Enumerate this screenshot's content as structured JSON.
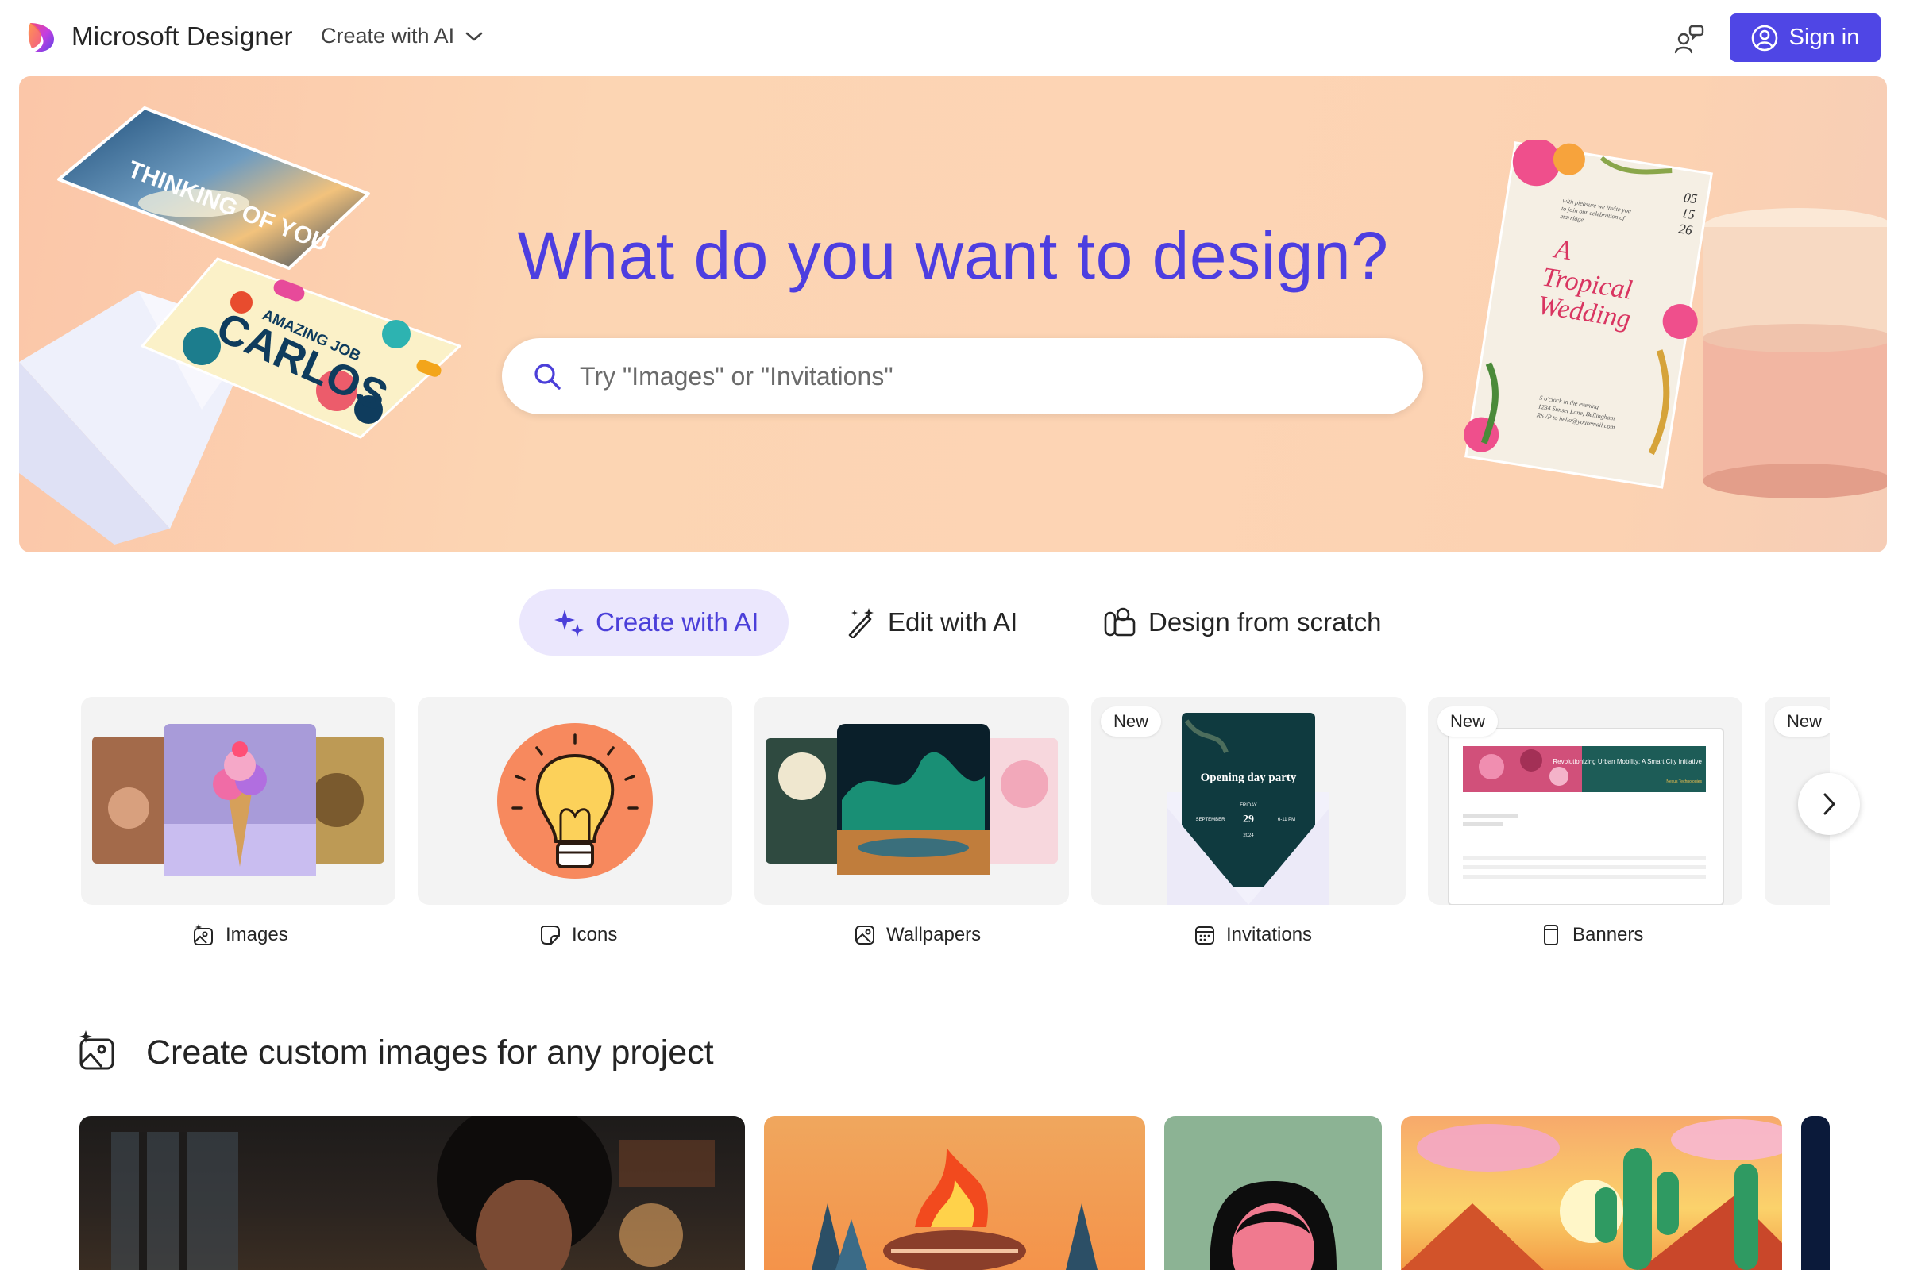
{
  "app": {
    "brand": "Microsoft Designer",
    "create_menu_label": "Create with AI",
    "sign_in_label": "Sign in",
    "accent_color": "#4f46e5"
  },
  "hero": {
    "title": "What do you want to design?",
    "search_placeholder": "Try \"Images\" or \"Invitations\"",
    "deco_cards": {
      "thinking_text": "THINKING OF YOU",
      "amazing_text": "AMAZING JOB",
      "carlos_text": "CARLOS",
      "invite_date": [
        "05",
        "15",
        "26"
      ],
      "invite_intro": [
        "with pleasure we invite you",
        "to join our celebration of",
        "marriage"
      ],
      "invite_title": [
        "A",
        "Tropical",
        "Wedding"
      ],
      "invite_footer": [
        "5 o'clock in the evening",
        "1234 Sunset Lane, Bellingham",
        "RSVP to hello@youremail.com"
      ]
    }
  },
  "tabs": [
    {
      "label": "Create with AI",
      "icon": "sparkle-icon",
      "active": true
    },
    {
      "label": "Edit with AI",
      "icon": "magic-wand-icon",
      "active": false
    },
    {
      "label": "Design from scratch",
      "icon": "shapes-icon",
      "active": false
    }
  ],
  "categories": [
    {
      "label": "Images",
      "icon": "image-sparkle-icon",
      "badge": ""
    },
    {
      "label": "Icons",
      "icon": "sticker-icon",
      "badge": ""
    },
    {
      "label": "Wallpapers",
      "icon": "wallpaper-icon",
      "badge": ""
    },
    {
      "label": "Invitations",
      "icon": "calendar-icon",
      "badge": "New",
      "preview": {
        "title": "Opening day party",
        "month": "SEPTEMBER",
        "day": "29",
        "weekday": "FRIDAY",
        "time": "6-11 PM",
        "year": "2024"
      }
    },
    {
      "label": "Banners",
      "icon": "banner-icon",
      "badge": "New",
      "preview": {
        "title": "Revolutionizing Urban Mobility: A Smart City Initiative",
        "subtitle": "Nexus Technologies"
      }
    },
    {
      "label": "",
      "icon": "",
      "badge": "New"
    }
  ],
  "section": {
    "title": "Create custom images for any project",
    "icon": "image-sparkle-icon"
  }
}
